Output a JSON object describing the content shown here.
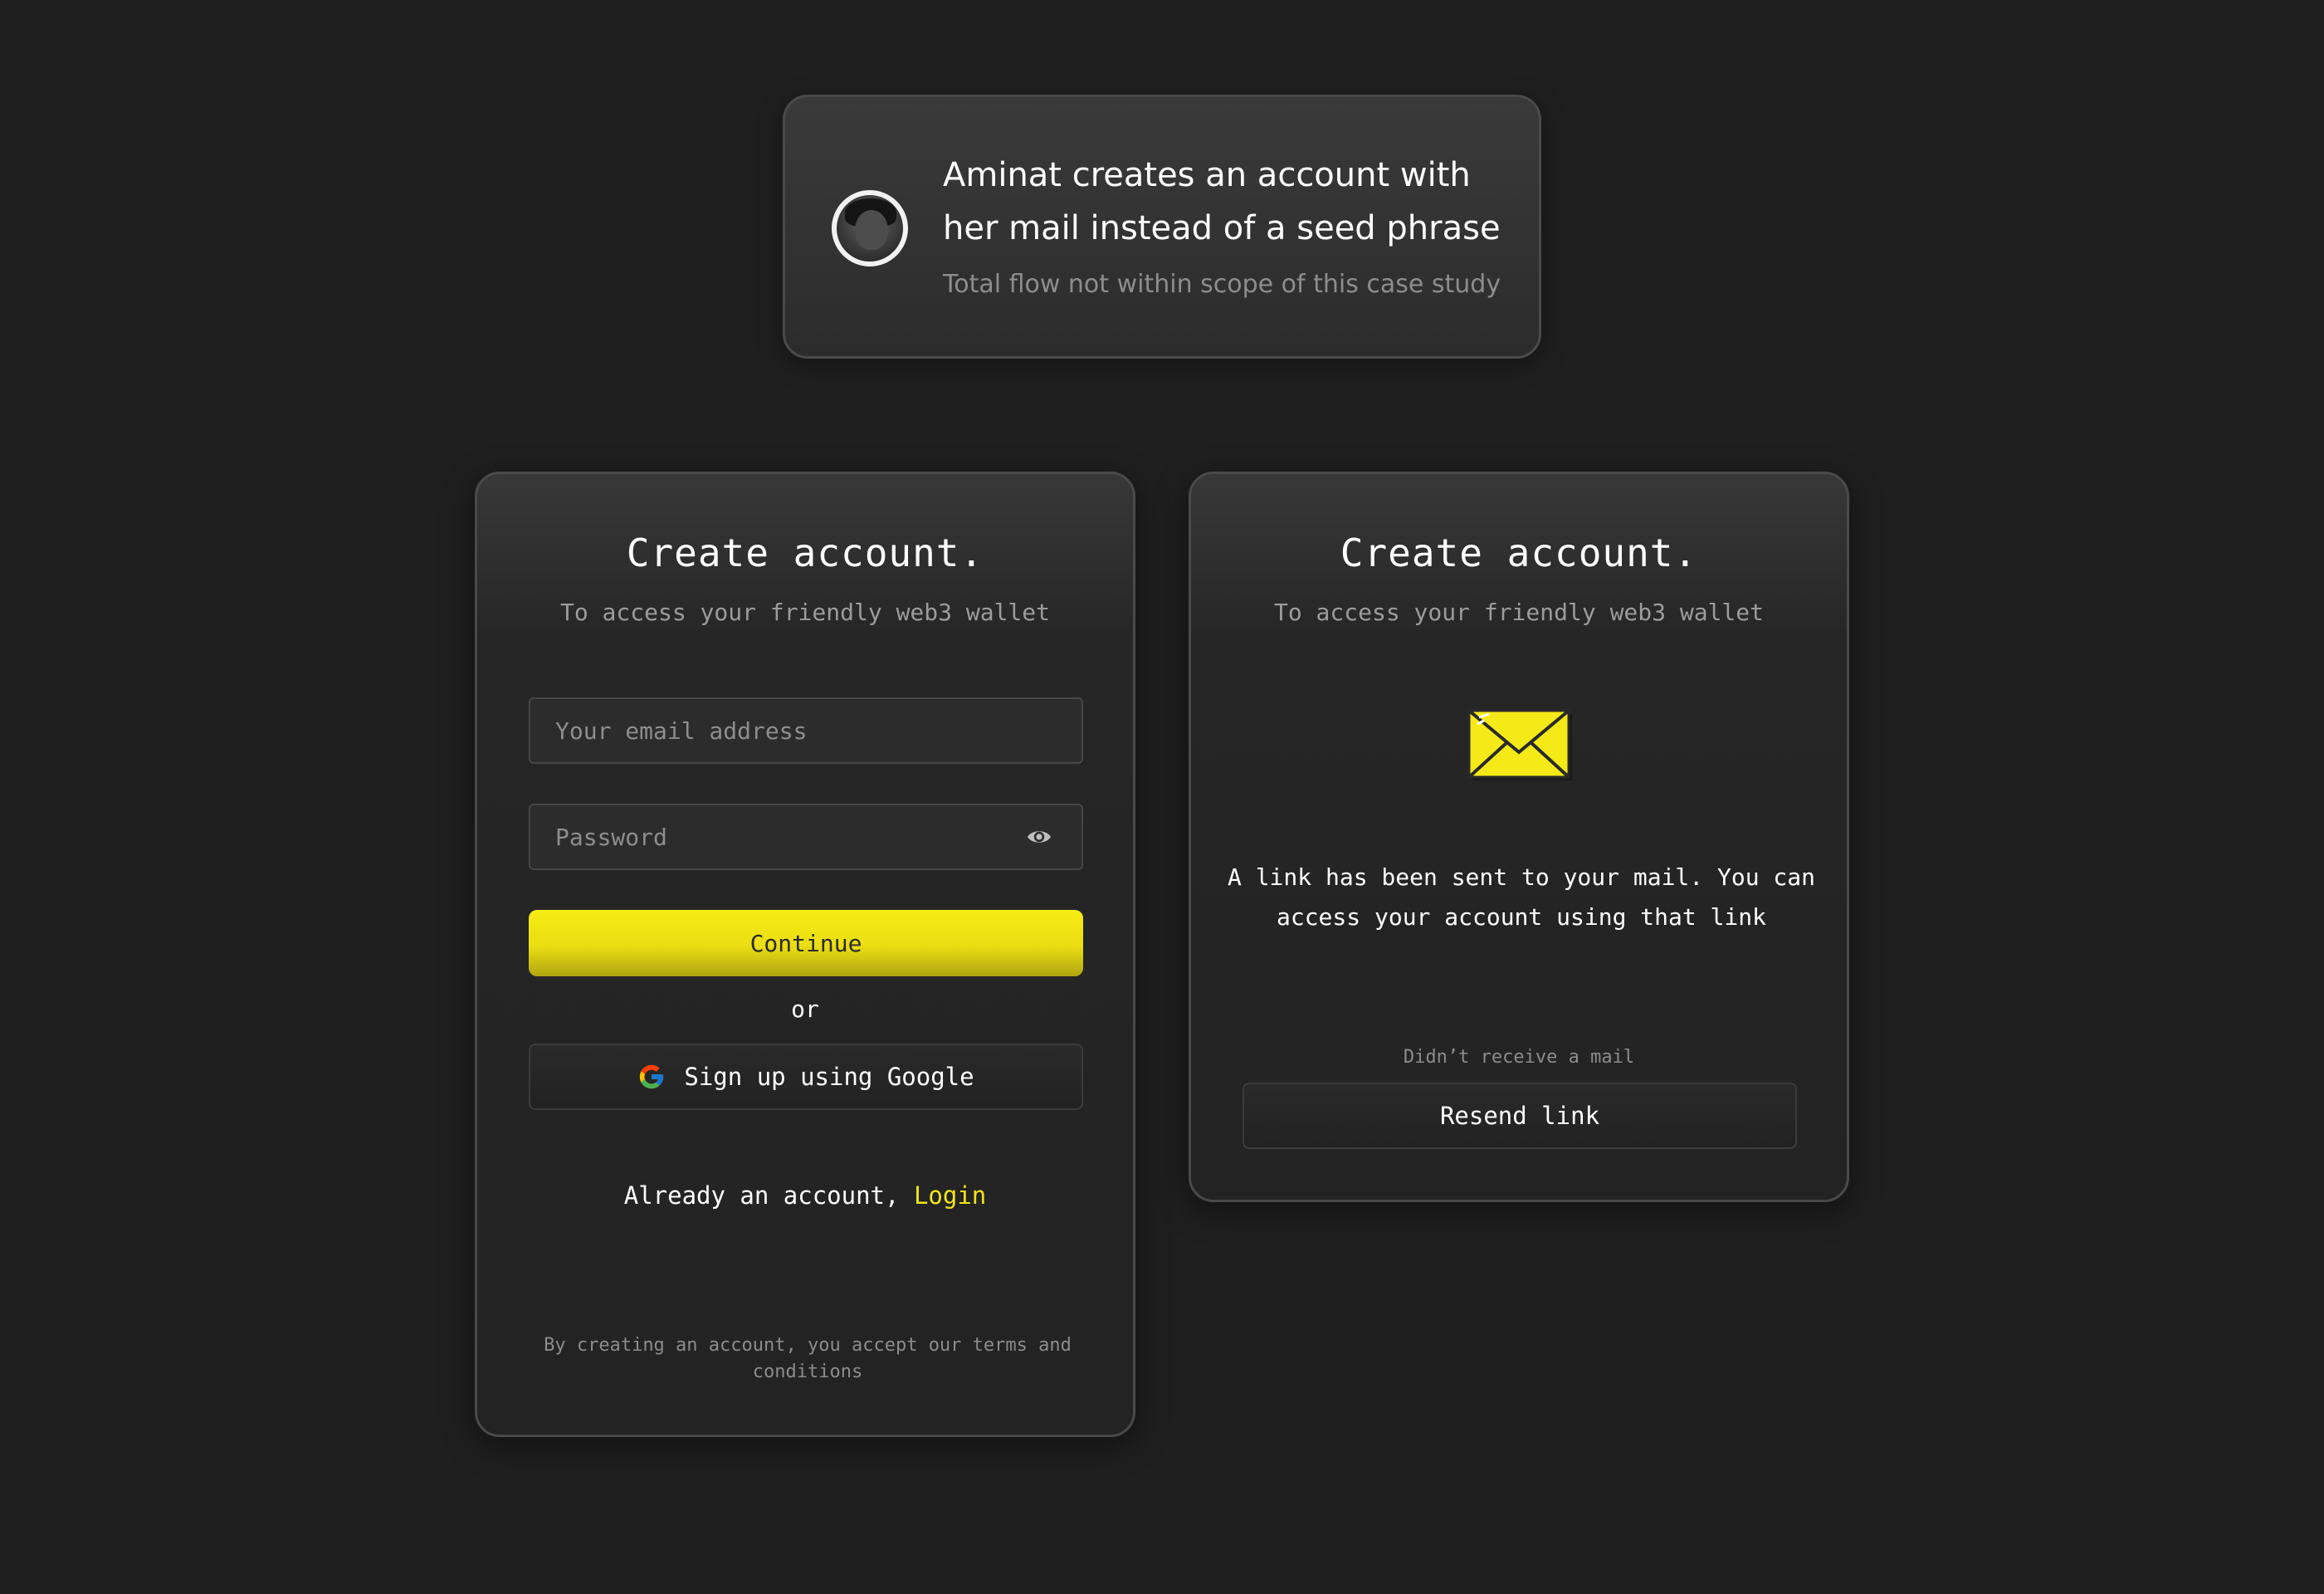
{
  "persona": {
    "title": "Aminat creates an account with her mail instead of a seed phrase",
    "subtitle": "Total flow not within scope of this case study"
  },
  "signup_form": {
    "title": "Create account.",
    "subtitle": "To access your friendly web3 wallet",
    "email_placeholder": "Your email address",
    "password_placeholder": "Password",
    "continue_label": "Continue",
    "or_label": "or",
    "google_label": "Sign up using Google",
    "login_prompt": "Already an account, ",
    "login_link": "Login",
    "terms": "By creating an account, you accept our terms and conditions"
  },
  "confirmation": {
    "title": "Create account.",
    "subtitle": "To access your friendly web3 wallet",
    "message": "A link has been sent to your mail. You can access your account using that link",
    "resend_hint": "Didn’t receive a mail",
    "resend_label": "Resend link"
  },
  "icons": {
    "avatar": "user-avatar",
    "password_toggle": "eye-icon",
    "google": "google-icon",
    "mail": "envelope-icon"
  },
  "colors": {
    "background": "#1f1f1f",
    "accent": "#f2e51a",
    "card_border": "#4a4a4a",
    "muted_text": "#8c8c8c"
  }
}
